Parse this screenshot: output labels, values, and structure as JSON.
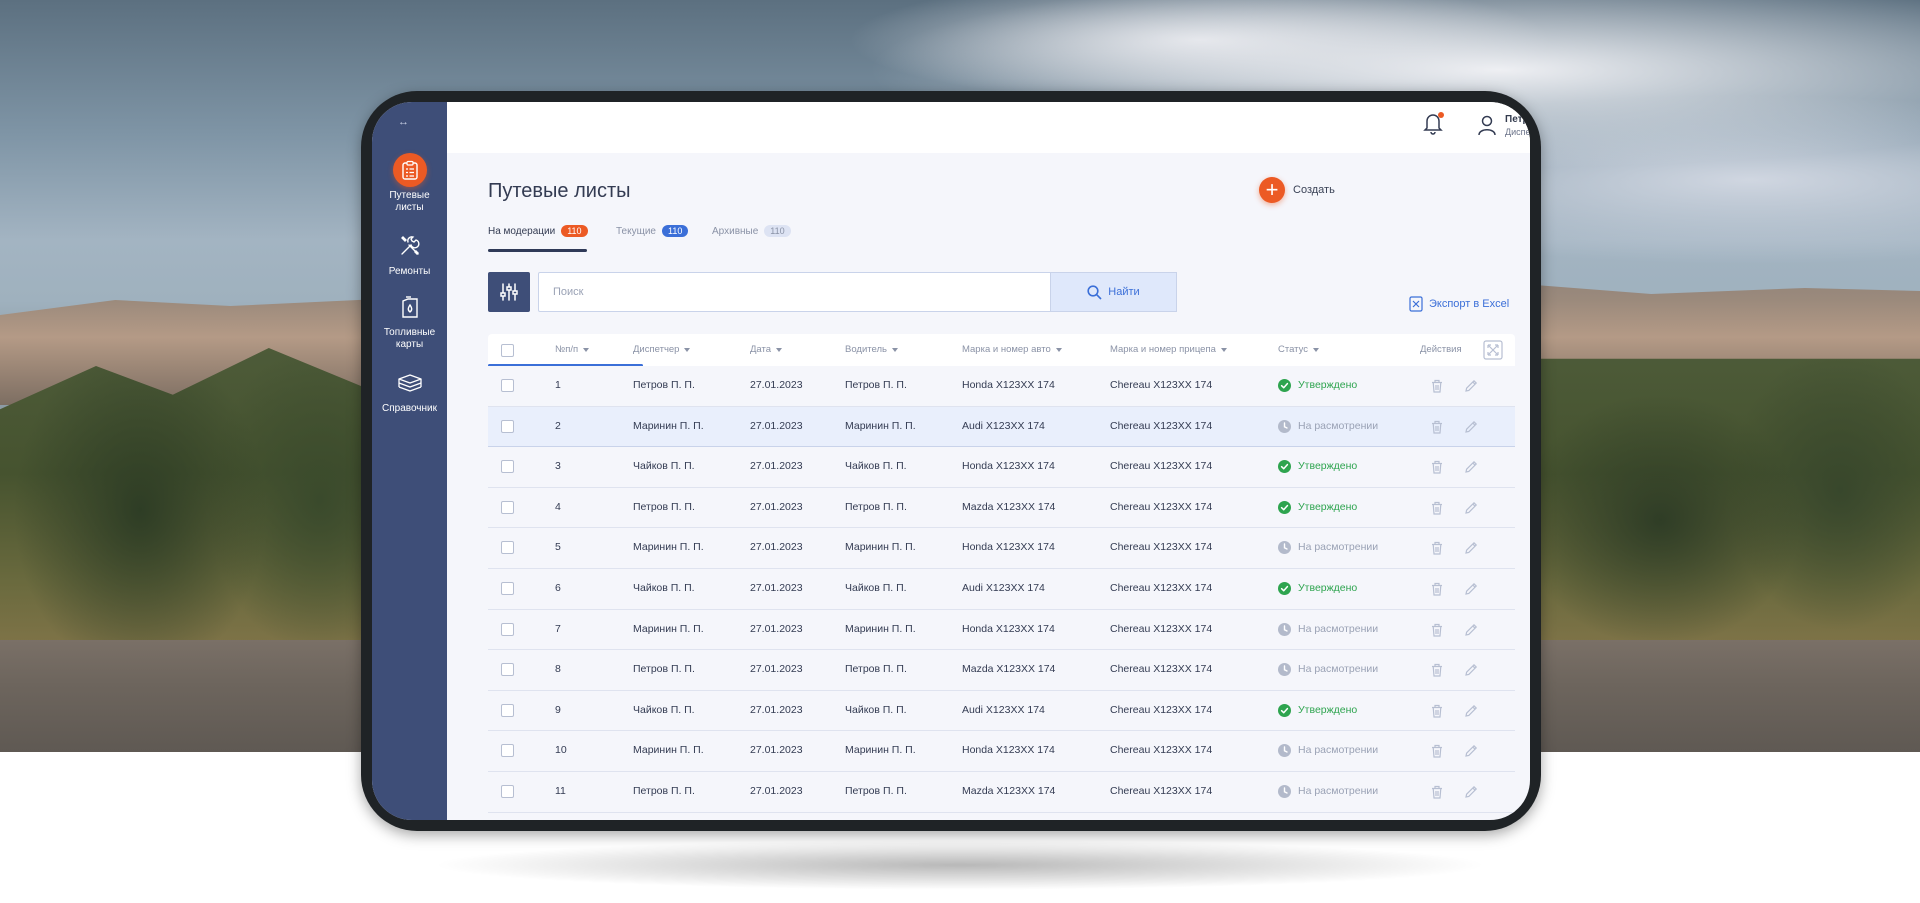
{
  "colors": {
    "accent": "#ec5a24",
    "primary": "#3b6fd8",
    "sidebar": "#3e4e78",
    "approved": "#2ea44f",
    "review": "#9aa2b5"
  },
  "sidebar": {
    "collapse_icon": "collapse-arrows-icon",
    "items": [
      {
        "label": "Путевые листы",
        "icon": "clipboard-list-icon",
        "active": true
      },
      {
        "label": "Ремонты",
        "icon": "wrench-screwdriver-icon",
        "active": false
      },
      {
        "label": "Топливные карты",
        "icon": "fuel-can-icon",
        "active": false
      },
      {
        "label": "Справочник",
        "icon": "stack-icon",
        "active": false
      }
    ]
  },
  "header": {
    "notification_icon": "bell-icon",
    "user": {
      "name": "Петров П.П.",
      "role": "Диспетчер",
      "icon": "user-icon"
    }
  },
  "page": {
    "title": "Путевые листы",
    "create_label": "Создать",
    "tabs": [
      {
        "label": "На модерации",
        "badge": "110",
        "badge_color": "#ec5a24",
        "active": true
      },
      {
        "label": "Текущие",
        "badge": "110",
        "badge_color": "#3b6fd8",
        "active": false
      },
      {
        "label": "Архивные",
        "badge": "110",
        "badge_color": "#c5cde6",
        "active": false
      }
    ],
    "search": {
      "placeholder": "Поиск",
      "value": "",
      "button_label": "Найти"
    },
    "export_label": "Экспорт в Excel"
  },
  "table": {
    "columns": [
      {
        "label": "№п/п",
        "sortable": true
      },
      {
        "label": "Диспетчер",
        "sortable": true
      },
      {
        "label": "Дата",
        "sortable": true
      },
      {
        "label": "Водитель",
        "sortable": true
      },
      {
        "label": "Марка и номер авто",
        "sortable": true
      },
      {
        "label": "Марка и номер прицепа",
        "sortable": true
      },
      {
        "label": "Статус",
        "sortable": true
      },
      {
        "label": "Действия",
        "sortable": false
      }
    ],
    "rows": [
      {
        "num": "1",
        "dispatcher": "Петров П. П.",
        "date": "27.01.2023",
        "driver": "Петров П. П.",
        "car": "Honda X123XX 174",
        "trailer": "Chereau X123XX 174",
        "status": "Утверждено",
        "approved": true
      },
      {
        "num": "2",
        "dispatcher": "Маринин П. П.",
        "date": "27.01.2023",
        "driver": "Маринин П. П.",
        "car": "Audi X123XX 174",
        "trailer": "Chereau X123XX 174",
        "status": "На расмотрении",
        "approved": false,
        "highlight": true
      },
      {
        "num": "3",
        "dispatcher": "Чайков П. П.",
        "date": "27.01.2023",
        "driver": "Чайков П. П.",
        "car": "Honda X123XX 174",
        "trailer": "Chereau X123XX 174",
        "status": "Утверждено",
        "approved": true
      },
      {
        "num": "4",
        "dispatcher": "Петров П. П.",
        "date": "27.01.2023",
        "driver": "Петров П. П.",
        "car": "Mazda X123XX 174",
        "trailer": "Chereau X123XX 174",
        "status": "Утверждено",
        "approved": true
      },
      {
        "num": "5",
        "dispatcher": "Маринин П. П.",
        "date": "27.01.2023",
        "driver": "Маринин П. П.",
        "car": "Honda X123XX 174",
        "trailer": "Chereau X123XX 174",
        "status": "На расмотрении",
        "approved": false
      },
      {
        "num": "6",
        "dispatcher": "Чайков П. П.",
        "date": "27.01.2023",
        "driver": "Чайков П. П.",
        "car": "Audi X123XX 174",
        "trailer": "Chereau X123XX 174",
        "status": "Утверждено",
        "approved": true
      },
      {
        "num": "7",
        "dispatcher": "Маринин П. П.",
        "date": "27.01.2023",
        "driver": "Маринин П. П.",
        "car": "Honda X123XX 174",
        "trailer": "Chereau X123XX 174",
        "status": "На расмотрении",
        "approved": false
      },
      {
        "num": "8",
        "dispatcher": "Петров П. П.",
        "date": "27.01.2023",
        "driver": "Петров П. П.",
        "car": "Mazda X123XX 174",
        "trailer": "Chereau X123XX 174",
        "status": "На расмотрении",
        "approved": false
      },
      {
        "num": "9",
        "dispatcher": "Чайков П. П.",
        "date": "27.01.2023",
        "driver": "Чайков П. П.",
        "car": "Audi X123XX 174",
        "trailer": "Chereau X123XX 174",
        "status": "Утверждено",
        "approved": true
      },
      {
        "num": "10",
        "dispatcher": "Маринин П. П.",
        "date": "27.01.2023",
        "driver": "Маринин П. П.",
        "car": "Honda X123XX 174",
        "trailer": "Chereau X123XX 174",
        "status": "На расмотрении",
        "approved": false
      },
      {
        "num": "11",
        "dispatcher": "Петров П. П.",
        "date": "27.01.2023",
        "driver": "Петров П. П.",
        "car": "Mazda X123XX 174",
        "trailer": "Chereau X123XX 174",
        "status": "На расмотрении",
        "approved": false
      }
    ]
  }
}
